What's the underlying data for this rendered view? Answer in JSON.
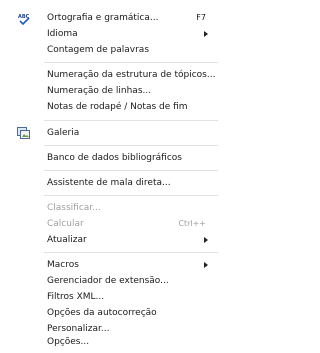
{
  "menu": {
    "items": [
      {
        "label": "Ortografia e gramática...",
        "shortcut": "F7",
        "submenu": false,
        "disabled": false
      },
      {
        "label": "Idioma",
        "shortcut": "",
        "submenu": true,
        "disabled": false
      },
      {
        "label": "Contagem de palavras",
        "shortcut": "",
        "submenu": false,
        "disabled": false
      },
      {
        "label": "Numeração da estrutura de tópicos...",
        "shortcut": "",
        "submenu": false,
        "disabled": false
      },
      {
        "label": "Numeração de linhas...",
        "shortcut": "",
        "submenu": false,
        "disabled": false
      },
      {
        "label": "Notas de rodapé / Notas de fim",
        "shortcut": "",
        "submenu": false,
        "disabled": false
      },
      {
        "label": "Galeria",
        "shortcut": "",
        "submenu": false,
        "disabled": false
      },
      {
        "label": "Banco de dados bibliográficos",
        "shortcut": "",
        "submenu": false,
        "disabled": false
      },
      {
        "label": "Assistente de mala direta...",
        "shortcut": "",
        "submenu": false,
        "disabled": false
      },
      {
        "label": "Classificar...",
        "shortcut": "",
        "submenu": false,
        "disabled": true
      },
      {
        "label": "Calcular",
        "shortcut": "Ctrl++",
        "submenu": false,
        "disabled": true
      },
      {
        "label": "Atualizar",
        "shortcut": "",
        "submenu": true,
        "disabled": false
      },
      {
        "label": "Macros",
        "shortcut": "",
        "submenu": true,
        "disabled": false
      },
      {
        "label": "Gerenciador de extensão...",
        "shortcut": "",
        "submenu": false,
        "disabled": false
      },
      {
        "label": "Filtros XML...",
        "shortcut": "",
        "submenu": false,
        "disabled": false
      },
      {
        "label": "Opções da autocorreção",
        "shortcut": "",
        "submenu": false,
        "disabled": false
      },
      {
        "label": "Personalizar...",
        "shortcut": "",
        "submenu": false,
        "disabled": false
      },
      {
        "label": "Opções...",
        "shortcut": "",
        "submenu": false,
        "disabled": false
      }
    ],
    "icons": {
      "spelling": "spellcheck-icon",
      "gallery": "gallery-icon"
    },
    "colors": {
      "disabled_text": "#a0a0a0",
      "separator": "#e2e2e2",
      "icon_blue": "#1f5fbf"
    }
  }
}
